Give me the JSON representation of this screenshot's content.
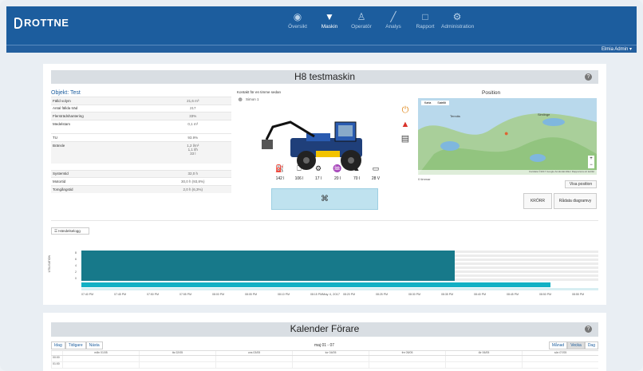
{
  "app": {
    "logo": "ROTTNE",
    "user_menu": "Elmia Admin ▾"
  },
  "nav": [
    {
      "label": "Översikt",
      "icon": "eye-icon",
      "glyph": "◉"
    },
    {
      "label": "Maskin",
      "icon": "pin-icon",
      "glyph": "▼"
    },
    {
      "label": "Operatör",
      "icon": "user-icon",
      "glyph": "♙"
    },
    {
      "label": "Analys",
      "icon": "chart-icon",
      "glyph": "╱"
    },
    {
      "label": "Rapport",
      "icon": "document-icon",
      "glyph": "□"
    },
    {
      "label": "Administration",
      "icon": "gear-icon",
      "glyph": "⚙"
    }
  ],
  "machine_card": {
    "title": "H8 testmaskin",
    "help": "?",
    "object_label": "Objekt: Test",
    "properties": [
      {
        "label": "Fälld volym",
        "value": "21,6 m³"
      },
      {
        "label": "Antal fällda träd",
        "value": "217"
      },
      {
        "label": "Flersträdshantering",
        "value": "33%"
      },
      {
        "label": "Medelstam",
        "value": "0,1 m³"
      },
      {
        "label": "TU",
        "value": "93.9%"
      },
      {
        "label": "Bränsle",
        "value": "1,2 l/m³\n1,1 l/h\n33 l"
      },
      {
        "label": "Systemtid",
        "value": "32,0 h"
      },
      {
        "label": "Motortid",
        "value": "30,0 h (93,8%)"
      },
      {
        "label": "Tomgångstid",
        "value": "2,0 h (6,3%)"
      }
    ],
    "contact_title": "Kontakt för en timme sedan",
    "contact_name": "Simon 1",
    "sensors": [
      {
        "icon": "fuel-icon",
        "glyph": "⛽",
        "value": "142 l"
      },
      {
        "icon": "hydraulic-icon",
        "glyph": "⎕",
        "value": "106 l"
      },
      {
        "icon": "gear-oil-icon",
        "glyph": "⚙",
        "value": "17 l"
      },
      {
        "icon": "adblue-icon",
        "glyph": "♒",
        "value": "20 l"
      },
      {
        "icon": "def-icon",
        "glyph": "▲",
        "value": "70 l"
      },
      {
        "icon": "battery-icon",
        "glyph": "▭",
        "value": "28 V"
      }
    ],
    "engine_button": "⌘",
    "position_title": "Position",
    "map": {
      "tabs": [
        "Karta",
        "Satellit"
      ],
      "places": [
        "Tennäs",
        "Simlinge"
      ],
      "footer": "Kartdata ©2017 Google Användarvillkor  Rapportera ett kartfel"
    },
    "slider_label": "0 timmar",
    "show_position": "Visa position",
    "status_button": "KRÖRR",
    "diagram_button": "Rådata diagramvy",
    "eventlog_button": "☰ Händelselogg",
    "timeline_ylabel": "UTILISATION",
    "timeline_date": "May 4, 2017",
    "timeline_ticks": [
      "07:40 PM",
      "07:45 PM",
      "07:50 PM",
      "07:55 PM",
      "08:00 PM",
      "08:05 PM",
      "08:10 PM",
      "08:15 PM",
      "08:20 PM",
      "08:25 PM",
      "08:30 PM",
      "08:35 PM",
      "08:40 PM",
      "08:45 PM",
      "08:50 PM",
      "08:55 PM"
    ],
    "timeline_yticks": [
      "8",
      "6",
      "4",
      "2",
      "0"
    ]
  },
  "calendar": {
    "title": "Kalender Förare",
    "help": "?",
    "nav_buttons": [
      "Idag",
      "Tidigare",
      "Nästa"
    ],
    "range": "maj 01 - 07",
    "view_buttons": [
      "Månad",
      "Vecka",
      "Dag"
    ],
    "active_view": "Vecka",
    "days": [
      "mån 01/05",
      "tis 02/05",
      "ons 03/05",
      "tor 04/05",
      "fre 05/05",
      "lör 06/05",
      "sön 07/05"
    ],
    "times": [
      "00:00",
      "01:00"
    ]
  }
}
